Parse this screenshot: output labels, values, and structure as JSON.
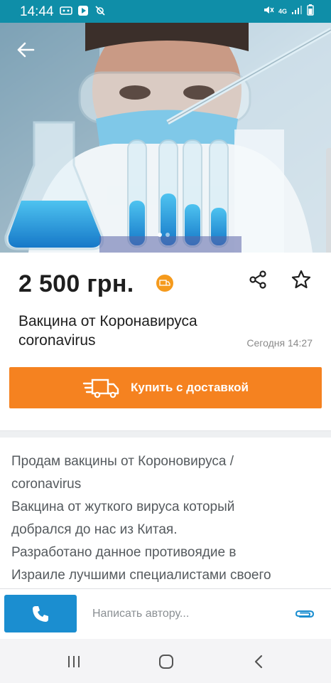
{
  "status_bar": {
    "time": "14:44",
    "left_icons": [
      "hd-icon",
      "play-store-icon",
      "gear-slash-icon"
    ],
    "right_icons": [
      "mute-icon",
      "4g-icon",
      "signal-icon",
      "battery-icon"
    ],
    "network": "4G"
  },
  "hero": {
    "image_count": 2,
    "active_index": 0
  },
  "listing": {
    "price": "2 500 грн.",
    "title": "Вакцина от Коронавируса coronavirus",
    "date": "Сегодня 14:27",
    "buy_button_label": "Купить с доставкой"
  },
  "description": {
    "lines": [
      "Продам вакцины от Короновируса /",
      "coronavirus",
      "Вакцина от жуткого вируса который",
      "добрался до нас из Китая.",
      "Разработано данное противоядие в",
      "Израиле лучшими специалистами своего"
    ]
  },
  "bottom_bar": {
    "message_placeholder": "Написать автору..."
  },
  "colors": {
    "status_bar": "#0f8ea8",
    "accent_orange": "#f58220",
    "call_blue": "#1b8ed0",
    "attach_blue": "#1b8ed0"
  }
}
